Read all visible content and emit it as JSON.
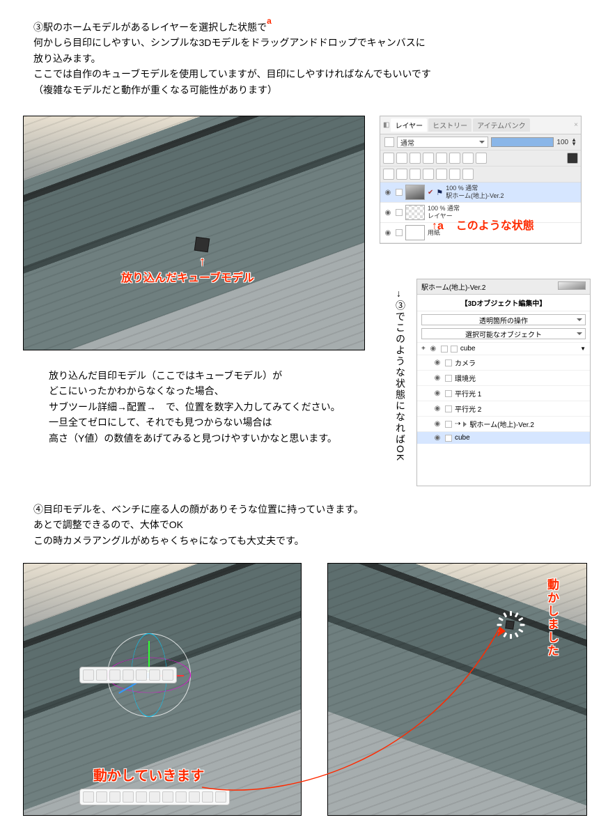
{
  "section3": {
    "heading": "③駅のホームモデルがあるレイヤーを選択した状態で",
    "heading_mark": "a",
    "p1": "何かしら目印にしやすい、シンプルな3Dモデルをドラッグアンドドロップでキャンバスに",
    "p2": "放り込みます。",
    "p3": "ここでは自作のキューブモデルを使用していますが、目印にしやすければなんでもいいです",
    "p4": "（複雑なモデルだと動作が重くなる可能性があります）"
  },
  "viewport1": {
    "cube_label": "放り込んだキューブモデル",
    "arrow": "↑"
  },
  "layers_panel": {
    "tab1": "レイヤー",
    "tab2": "ヒストリー",
    "tab3": "アイテムバンク",
    "mode": "通常",
    "opacity_value": "100",
    "item1_meta": "100 %  通常",
    "item1_name": "駅ホーム(地上)-Ver.2",
    "item2_meta": "100 %  通常",
    "item2_name": "レイヤー",
    "item3_name": "用紙",
    "annotation_arrow": "↑a",
    "annotation_text": "このような状態"
  },
  "middle_note": {
    "l1": "放り込んだ目印モデル（ここではキューブモデル）が",
    "l2": "どこにいったかわからなくなった場合、",
    "l3": "サブツール詳細→配置→　で、位置を数字入力してみてください。",
    "l4": "一旦全てゼロにして、それでも見つからない場合は",
    "l5": "高さ（Y値）の数値をあげてみると見つけやすいかなと思います。"
  },
  "obj_panel": {
    "title": "駅ホーム(地上)-Ver.2",
    "header": "【3Dオブジェクト編集中】",
    "dd1": "透明箇所の操作",
    "dd2": "選択可能なオブジェクト",
    "row_cube_top": "cube",
    "row_camera": "カメラ",
    "row_env": "環境光",
    "row_light1": "平行光 1",
    "row_light2": "平行光 2",
    "row_station": "駅ホーム(地上)-Ver.2",
    "row_cube_sel": "cube"
  },
  "side_note": "→③でこのような状態になればOK",
  "section4": {
    "heading": "④目印モデルを、ベンチに座る人の顔がありそうな位置に持っていきます。",
    "p1": "あとで調整できるので、大体でOK",
    "p2": "この時カメラアングルがめちゃくちゃになっても大丈夫です。"
  },
  "viewport_left": {
    "label": "動かしていきます"
  },
  "viewport_right": {
    "label": "動かしました"
  }
}
